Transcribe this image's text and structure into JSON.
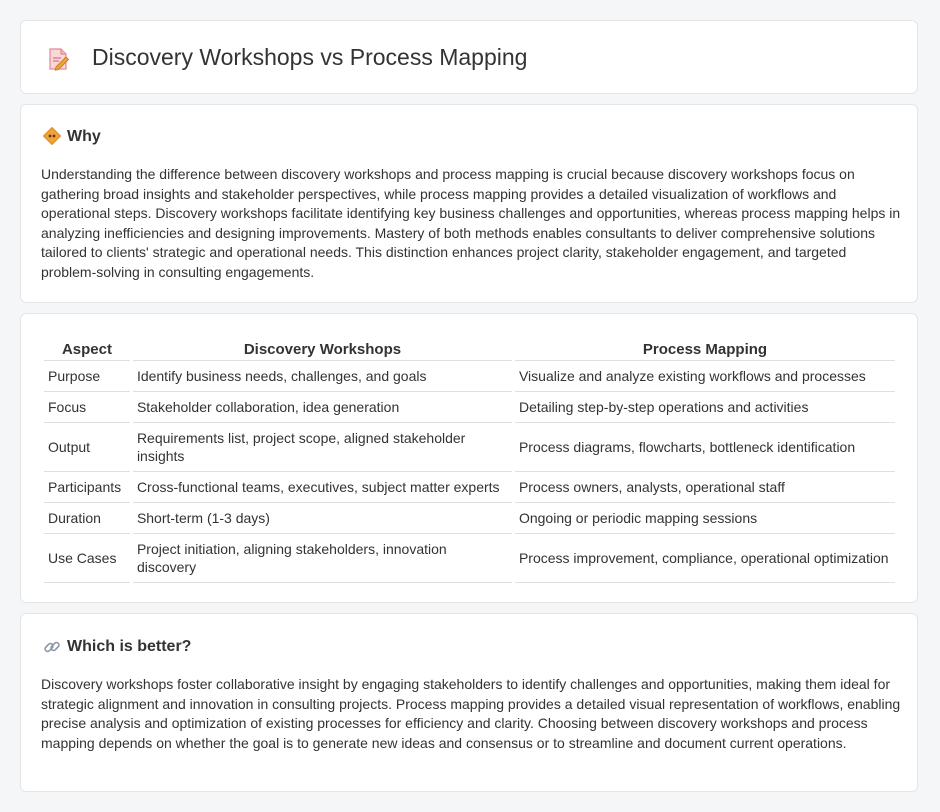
{
  "page": {
    "title": "Discovery Workshops vs Process Mapping",
    "title_icon": "document-pencil-icon"
  },
  "why": {
    "icon": "diamond-sign-icon",
    "heading": "Why",
    "text": "Understanding the difference between discovery workshops and process mapping is crucial because discovery workshops focus on gathering broad insights and stakeholder perspectives, while process mapping provides a detailed visualization of workflows and operational steps. Discovery workshops facilitate identifying key business challenges and opportunities, whereas process mapping helps in analyzing inefficiencies and designing improvements. Mastery of both methods enables consultants to deliver comprehensive solutions tailored to clients' strategic and operational needs. This distinction enhances project clarity, stakeholder engagement, and targeted problem-solving in consulting engagements."
  },
  "table": {
    "headers": [
      "Aspect",
      "Discovery Workshops",
      "Process Mapping"
    ],
    "rows": [
      [
        "Purpose",
        "Identify business needs, challenges, and goals",
        "Visualize and analyze existing workflows and processes"
      ],
      [
        "Focus",
        "Stakeholder collaboration, idea generation",
        "Detailing step-by-step operations and activities"
      ],
      [
        "Output",
        "Requirements list, project scope, aligned stakeholder insights",
        "Process diagrams, flowcharts, bottleneck identification"
      ],
      [
        "Participants",
        "Cross-functional teams, executives, subject matter experts",
        "Process owners, analysts, operational staff"
      ],
      [
        "Duration",
        "Short-term (1-3 days)",
        "Ongoing or periodic mapping sessions"
      ],
      [
        "Use Cases",
        "Project initiation, aligning stakeholders, innovation discovery",
        "Process improvement, compliance, operational optimization"
      ]
    ]
  },
  "better": {
    "icon": "link-icon",
    "heading": "Which is better?",
    "text": "Discovery workshops foster collaborative insight by engaging stakeholders to identify challenges and opportunities, making them ideal for strategic alignment and innovation in consulting projects. Process mapping provides a detailed visual representation of workflows, enabling precise analysis and optimization of existing processes for efficiency and clarity. Choosing between discovery workshops and process mapping depends on whether the goal is to generate new ideas and consensus or to streamline and document current operations."
  },
  "colors": {
    "background": "#f5f6f8",
    "card": "#ffffff",
    "border": "#e3e5e8",
    "text": "#333333",
    "accent_orange": "#f0a33a",
    "icon_pink": "#e87f86"
  }
}
